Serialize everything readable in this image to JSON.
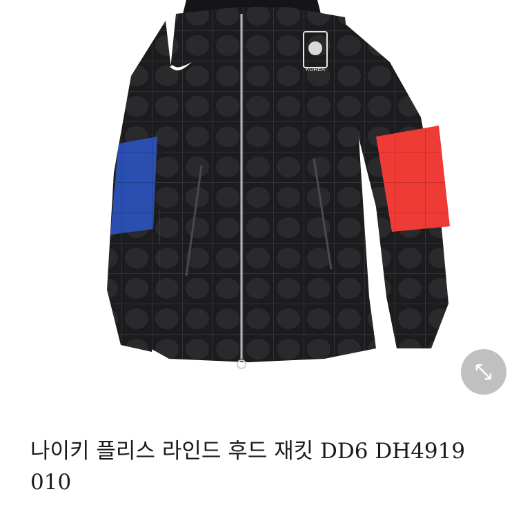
{
  "product": {
    "image_alt": "Nike Korea quilted hooded jacket",
    "brand_badge_text": "KOREA",
    "title": "나이키 플리스 라인드 후드 재킷 DD6 DH4919 010"
  },
  "controls": {
    "expand_icon": "expand-diagonal-arrows-icon"
  },
  "colors": {
    "jacket_body": "#1c1c1e",
    "left_band": "#2b4fb0",
    "right_band": "#ee3b36",
    "expand_button": "#8c8c8c"
  }
}
